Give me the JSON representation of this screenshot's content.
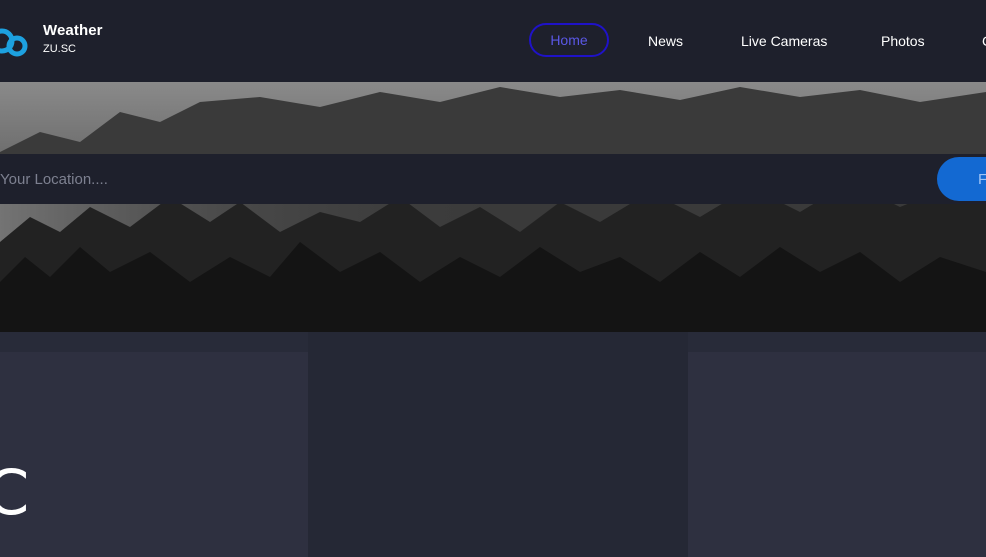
{
  "brand": {
    "title": "Weather",
    "subtitle": "ZU.SC",
    "icon": "cloud-logo-icon"
  },
  "nav": {
    "items": [
      {
        "label": "Home",
        "active": true
      },
      {
        "label": "News"
      },
      {
        "label": "Live Cameras"
      },
      {
        "label": "Photos"
      },
      {
        "label": "C"
      }
    ]
  },
  "search": {
    "placeholder": "Your Location....",
    "button_label": "F"
  },
  "current": {
    "temp_text": "C"
  },
  "colors": {
    "header_bg": "#1e202c",
    "active_border": "#1f12c8",
    "active_text": "#5b58e6",
    "button_bg": "#1369d2",
    "logo": "#1da1e0"
  }
}
